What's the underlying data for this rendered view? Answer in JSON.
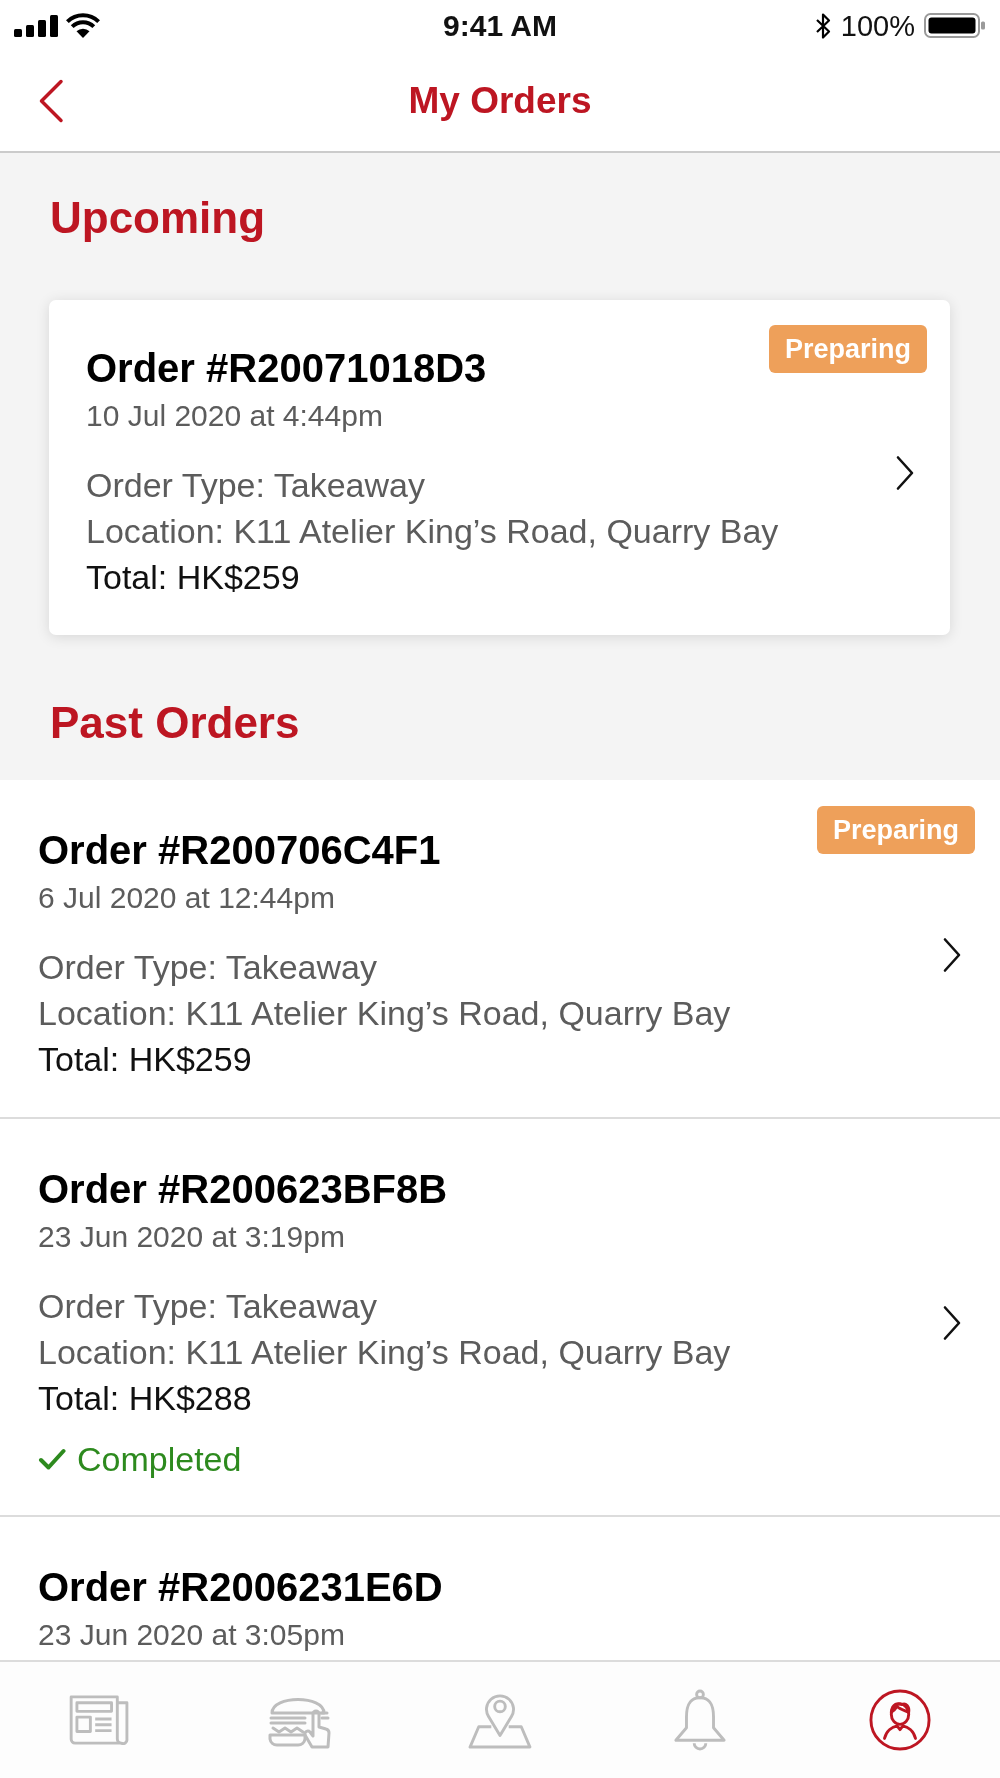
{
  "status_bar": {
    "time": "9:41 AM",
    "battery": "100%"
  },
  "header": {
    "title": "My Orders"
  },
  "upcoming": {
    "heading": "Upcoming",
    "orders": [
      {
        "number": "Order #R20071018D3",
        "date": "10 Jul 2020 at 4:44pm",
        "type": "Order Type: Takeaway",
        "location": "Location: K11 Atelier King’s Road, Quarry Bay",
        "total": "Total: HK$259",
        "status": {
          "kind": "badge",
          "label": "Preparing"
        }
      }
    ]
  },
  "past_orders": {
    "heading": "Past Orders",
    "orders": [
      {
        "number": "Order #R200706C4F1",
        "date": "6 Jul 2020 at 12:44pm",
        "type": "Order Type: Takeaway",
        "location": "Location: K11 Atelier King’s Road, Quarry Bay",
        "total": "Total: HK$259",
        "status": {
          "kind": "badge",
          "label": "Preparing"
        }
      },
      {
        "number": "Order #R200623BF8B",
        "date": "23 Jun 2020 at 3:19pm",
        "type": "Order Type: Takeaway",
        "location": "Location: K11 Atelier King’s Road, Quarry Bay",
        "total": "Total: HK$288",
        "status": {
          "kind": "check",
          "label": "Completed"
        }
      },
      {
        "number": "Order #R2006231E6D",
        "date": "23 Jun 2020 at 3:05pm"
      }
    ]
  },
  "tab_bar": {
    "tabs": [
      {
        "kind": "news",
        "selected": false
      },
      {
        "kind": "menu",
        "selected": false
      },
      {
        "kind": "stores",
        "selected": false
      },
      {
        "kind": "alerts",
        "selected": false
      },
      {
        "kind": "account",
        "selected": true
      }
    ]
  }
}
